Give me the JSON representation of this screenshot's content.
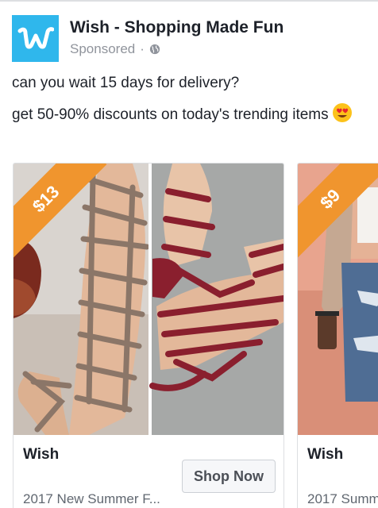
{
  "post": {
    "page_name": "Wish - Shopping Made Fun",
    "sponsored": "Sponsored",
    "separator": "·",
    "message_line1": "can you wait 15 days for delivery?",
    "message_line2": "get 50-90% discounts on today's trending items",
    "emoji": "heart-eyes-emoji"
  },
  "carousel": {
    "cards": [
      {
        "price": "$13",
        "title": "Wish",
        "description": "2017 New Summer F...",
        "cta": "Shop Now"
      },
      {
        "price": "$9",
        "title": "Wish",
        "description": "2017 Summ"
      }
    ]
  },
  "colors": {
    "brand_blue": "#2fb7ec",
    "ribbon_orange": "#f0952e",
    "sandal_burgundy": "#8a1f2e",
    "sandal_taupe": "#8b7668"
  }
}
